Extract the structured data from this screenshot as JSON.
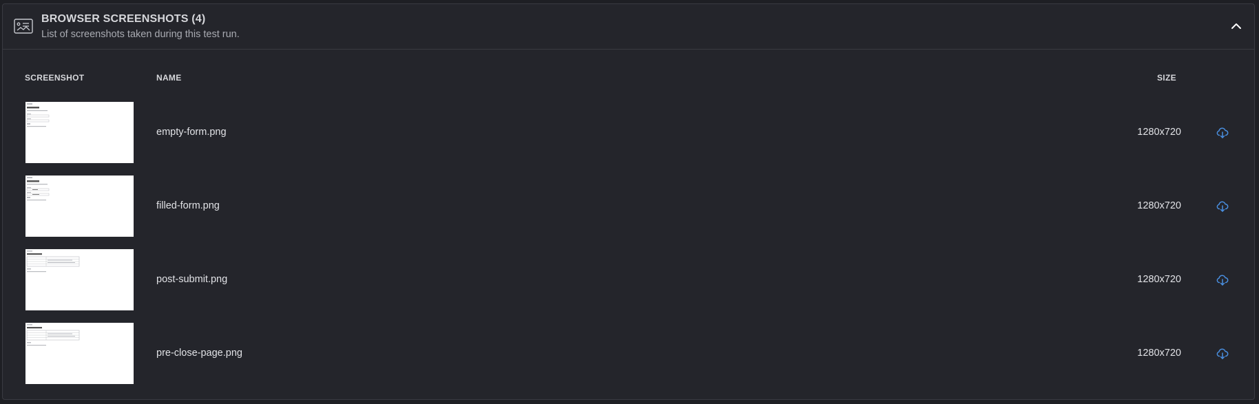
{
  "panel": {
    "title": "BROWSER SCREENSHOTS (4)",
    "subtitle": "List of screenshots taken during this test run.",
    "header_icon": "image-card-icon",
    "collapse_icon": "chevron-up-icon"
  },
  "table": {
    "headers": {
      "screenshot": "SCREENSHOT",
      "name": "NAME",
      "size": "SIZE"
    },
    "rows": [
      {
        "name": "empty-form.png",
        "size": "1280x720",
        "thumb_style": "form"
      },
      {
        "name": "filled-form.png",
        "size": "1280x720",
        "thumb_style": "form-filled"
      },
      {
        "name": "post-submit.png",
        "size": "1280x720",
        "thumb_style": "table"
      },
      {
        "name": "pre-close-page.png",
        "size": "1280x720",
        "thumb_style": "table"
      }
    ]
  },
  "colors": {
    "background": "#1e1f24",
    "panel": "#24252b",
    "border": "#3a3b42",
    "accent": "#4a90e2"
  }
}
